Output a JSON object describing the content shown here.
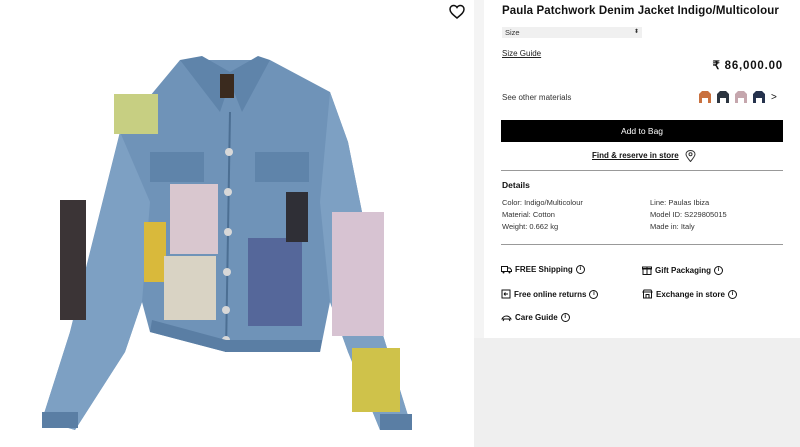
{
  "product": {
    "title": "Paula Patchwork Denim Jacket Indigo/Multicolour",
    "price": "₹ 86,000.00",
    "image_alt": "Paula Patchwork Denim Jacket"
  },
  "wishlist": {
    "icon": "heart-icon"
  },
  "size": {
    "label": "Size",
    "chevron": "⬍"
  },
  "size_guide": "Size Guide",
  "other_materials": {
    "label": "See other materials",
    "next": ">",
    "swatch_colors": [
      "#c9713f",
      "#2c3540",
      "#c5a6ad",
      "#25324d"
    ]
  },
  "add_to_bag": "Add to Bag",
  "find_store": "Find & reserve in store",
  "details": {
    "heading": "Details",
    "left": [
      "Color: Indigo/Multicolour",
      "Material: Cotton",
      "Weight: 0.662 kg"
    ],
    "right": [
      "Line: Paulas Ibiza",
      "Model ID: S229805015",
      "Made in: Italy"
    ]
  },
  "services": {
    "free_shipping": "FREE Shipping",
    "gift_packaging": "Gift Packaging",
    "free_returns": "Free online returns",
    "exchange_store": "Exchange in store",
    "care_guide": "Care Guide",
    "info_glyph": "i"
  }
}
